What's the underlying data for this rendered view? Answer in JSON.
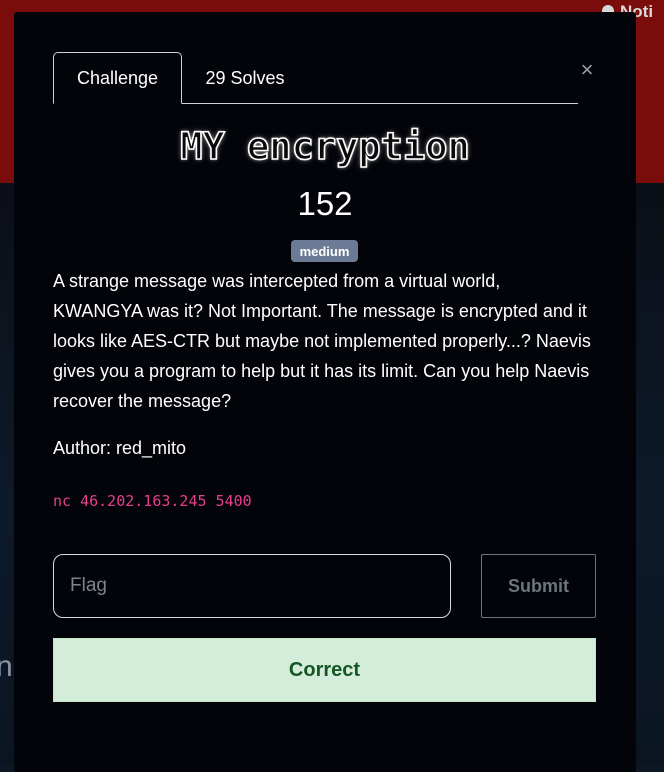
{
  "background": {
    "notifications_label": "Noti",
    "partial_letter": "n"
  },
  "tabs": [
    {
      "label": "Challenge",
      "active": true
    },
    {
      "label": "29 Solves",
      "active": false
    }
  ],
  "close_glyph": "×",
  "challenge": {
    "name": "MY encryption",
    "points": "152",
    "difficulty": "medium",
    "description": "A strange message was intercepted from a virtual world, KWANGYA was it? Not Important. The message is encrypted and it looks like AES-CTR but maybe not implemented properly...? Naevis gives you a program to help but it has its limit. Can you help Naevis recover the message?",
    "author": "Author: red_mito",
    "connection": "nc 46.202.163.245 5400"
  },
  "form": {
    "flag_placeholder": "Flag",
    "flag_value": "",
    "submit_label": "Submit"
  },
  "result": {
    "message": "Correct",
    "status": "success"
  },
  "colors": {
    "modal_bg": "#020409",
    "header_red": "#7a0c0c",
    "difficulty_badge": "#6c7b95",
    "connection_text": "#e83e8c",
    "success_bg": "#d4edda",
    "success_text": "#155724"
  }
}
